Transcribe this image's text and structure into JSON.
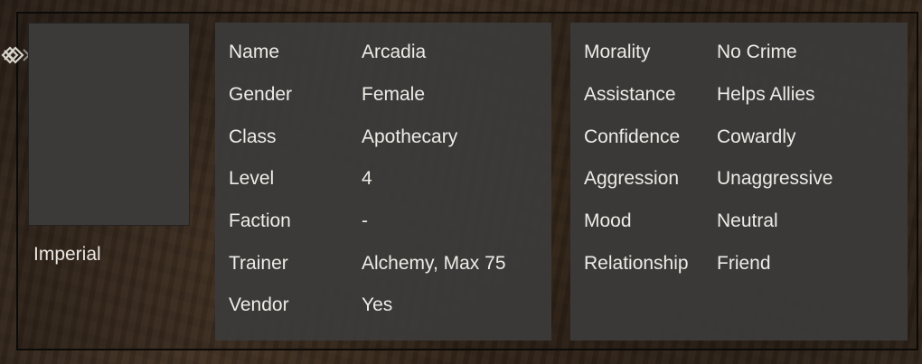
{
  "portrait": {
    "race": "Imperial"
  },
  "info": [
    {
      "label": "Name",
      "value": "Arcadia"
    },
    {
      "label": "Gender",
      "value": "Female"
    },
    {
      "label": "Class",
      "value": "Apothecary"
    },
    {
      "label": "Level",
      "value": "4"
    },
    {
      "label": "Faction",
      "value": "-"
    },
    {
      "label": "Trainer",
      "value": "Alchemy, Max 75"
    },
    {
      "label": "Vendor",
      "value": "Yes"
    }
  ],
  "ai": [
    {
      "label": "Morality",
      "value": "No Crime"
    },
    {
      "label": "Assistance",
      "value": "Helps Allies"
    },
    {
      "label": "Confidence",
      "value": "Cowardly"
    },
    {
      "label": "Aggression",
      "value": "Unaggressive"
    },
    {
      "label": "Mood",
      "value": "Neutral"
    },
    {
      "label": "Relationship",
      "value": "Friend"
    }
  ],
  "icons": {
    "corner_decoration": "knot-ornament-icon"
  },
  "colors": {
    "panel": "#3c3b3a",
    "text": "#eeebe7"
  }
}
